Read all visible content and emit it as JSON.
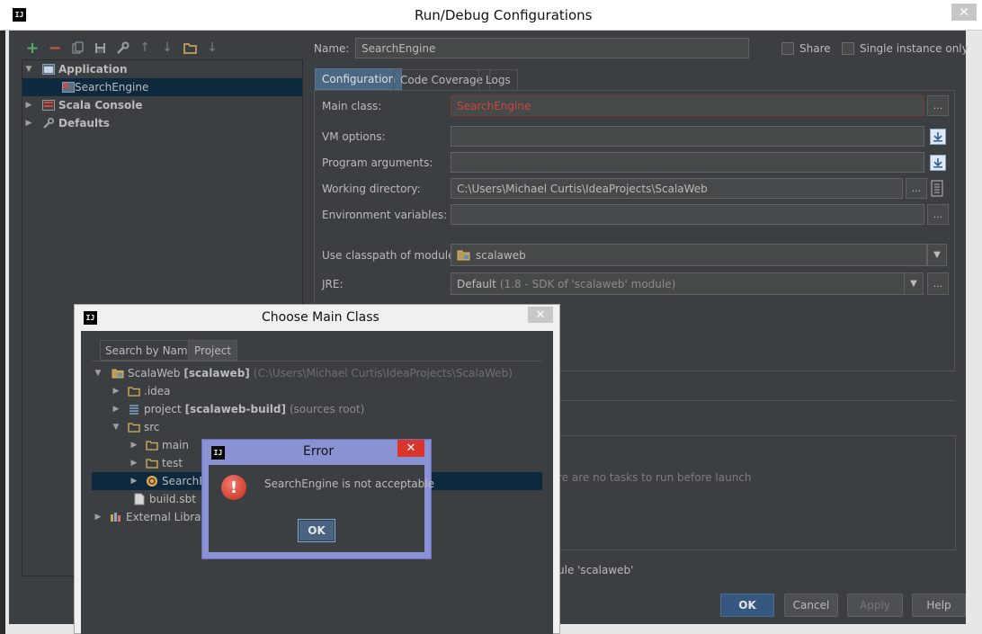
{
  "main_window": {
    "app_icon": "IJ",
    "title": "Run/Debug Configurations",
    "close_glyph": "✕"
  },
  "toolbar": {
    "icons": [
      "add-icon",
      "remove-icon",
      "copy-icon",
      "save-icon",
      "wrench-icon",
      "move-up-icon",
      "move-down-icon",
      "folder-icon",
      "sort-icon"
    ],
    "add_glyph": "+",
    "remove_glyph": "−",
    "up_glyph": "↑",
    "down_glyph": "↓",
    "sort_glyph": "↓"
  },
  "config_tree": {
    "expanded_glyph": "▼",
    "collapsed_glyph": "▶",
    "items": [
      {
        "label": "Application",
        "bold": true
      },
      {
        "label": "SearchEngine",
        "selected": true
      },
      {
        "label": "Scala Console",
        "bold": true
      },
      {
        "label": "Defaults",
        "bold": true
      }
    ]
  },
  "header": {
    "name_label": "Name:",
    "name_value": "SearchEngine",
    "share_label": "Share",
    "single_instance_label": "Single instance only"
  },
  "tabs": [
    {
      "label": "Configuration",
      "active": true
    },
    {
      "label": "Code Coverage"
    },
    {
      "label": "Logs"
    }
  ],
  "form": {
    "main_class_label": "Main class:",
    "main_class_value": "SearchEngine",
    "vm_options_label": "VM options:",
    "program_arguments_label": "Program arguments:",
    "working_directory_label": "Working directory:",
    "working_directory_value": "C:\\Users\\Michael Curtis\\IdeaProjects\\ScalaWeb",
    "environment_variables_label": "Environment variables:",
    "classpath_label": "Use classpath of module:",
    "classpath_value": "scalaweb",
    "jre_label": "JRE:",
    "jre_value": "Default",
    "jre_detail": "(1.8 - SDK of 'scalaweb' module)",
    "ellipsis": "...",
    "dropdown_glyph": "▼"
  },
  "before_launch": {
    "empty_text": "re are no tasks to run before launch",
    "module_text": "ule 'scalaweb'"
  },
  "buttons": {
    "ok": "OK",
    "cancel": "Cancel",
    "apply": "Apply",
    "help": "Help"
  },
  "choose_main_class": {
    "title": "Choose Main Class",
    "close_glyph": "✕",
    "tabs": [
      {
        "label": "Search by Name"
      },
      {
        "label": "Project",
        "active": true
      }
    ],
    "tree": {
      "root_name": "ScalaWeb",
      "root_module": "[scalaweb]",
      "root_path": "(C:\\Users\\Michael Curtis\\IdeaProjects\\ScalaWeb)",
      "idea": ".idea",
      "project_name": "project",
      "project_module": "[scalaweb-build]",
      "project_note": "(sources root)",
      "src": "src",
      "main": "main",
      "test": "test",
      "search_engine": "SearchE",
      "build_sbt": "build.sbt",
      "external": "External Librarie"
    }
  },
  "error_dialog": {
    "title": "Error",
    "message": "SearchEngine is not acceptable",
    "ok": "OK",
    "icon_glyph": "!",
    "close_glyph": "✕"
  },
  "colors": {
    "accent_selection": "#0d293e",
    "error_red": "#c5281b",
    "error_text": "#d0463c"
  }
}
